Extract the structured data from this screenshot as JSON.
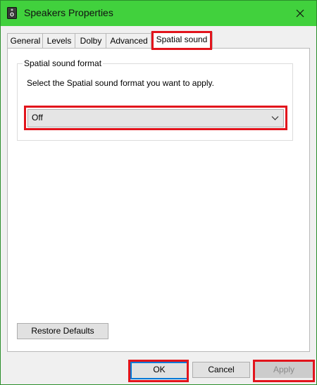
{
  "window": {
    "title": "Speakers Properties"
  },
  "tabs": [
    {
      "label": "General"
    },
    {
      "label": "Levels"
    },
    {
      "label": "Dolby"
    },
    {
      "label": "Advanced"
    },
    {
      "label": "Spatial sound",
      "active": true
    }
  ],
  "spatial": {
    "group_label": "Spatial sound format",
    "description": "Select the Spatial sound format you want to apply.",
    "format_selected": "Off"
  },
  "buttons": {
    "restore_defaults": "Restore Defaults",
    "ok": "OK",
    "cancel": "Cancel",
    "apply": "Apply"
  },
  "colors": {
    "titlebar": "#41d13d",
    "highlight": "#e2141c",
    "focus": "#0078d7"
  },
  "icons": {
    "window": "speaker-icon",
    "close": "close-icon",
    "dropdown": "chevron-down-icon"
  }
}
